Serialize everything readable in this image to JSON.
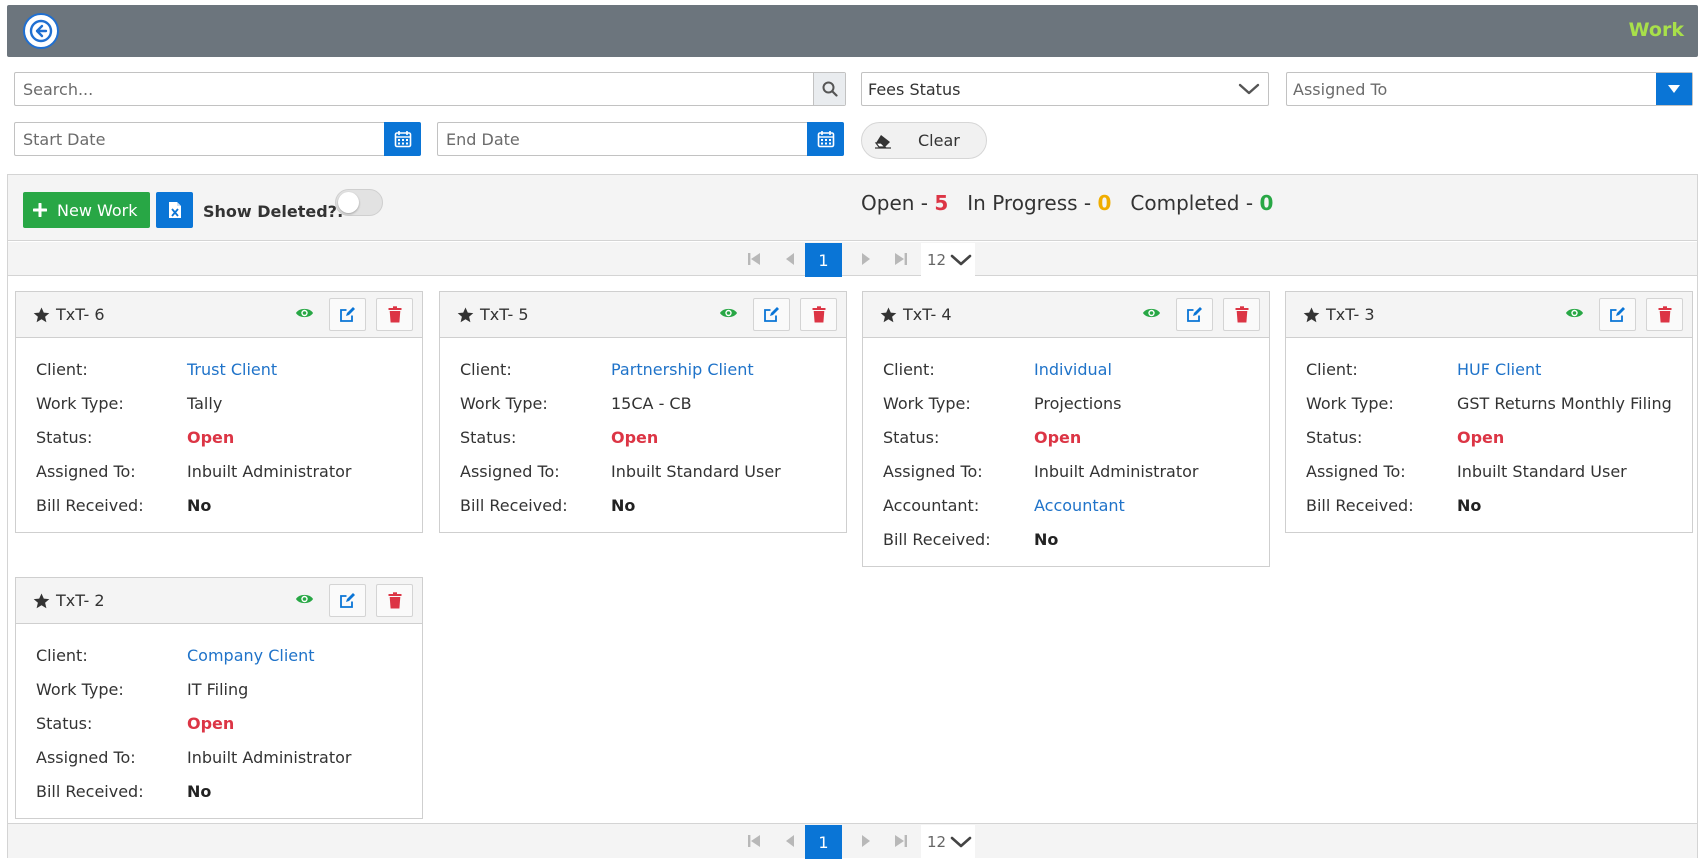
{
  "header": {
    "title": "Work"
  },
  "filters": {
    "search_placeholder": "Search...",
    "fees_status": "Fees Status",
    "assigned_to": "Assigned To",
    "start_date_placeholder": "Start Date",
    "end_date_placeholder": "End Date",
    "clear_label": "Clear"
  },
  "toolbar": {
    "new_work_label": "New Work",
    "show_deleted_label": "Show Deleted?:",
    "open_label": "Open -",
    "open_count": "5",
    "in_progress_label": "In Progress -",
    "in_progress_count": "0",
    "completed_label": "Completed -",
    "completed_count": "0"
  },
  "pager": {
    "current_page": "1",
    "page_size": "12"
  },
  "cards": [
    {
      "title": "TxT- 6",
      "rows": [
        {
          "label": "Client:",
          "value": "Trust Client",
          "style": "link"
        },
        {
          "label": "Work Type:",
          "value": "Tally",
          "style": "plain"
        },
        {
          "label": "Status:",
          "value": "Open",
          "style": "open"
        },
        {
          "label": "Assigned To:",
          "value": "Inbuilt Administrator",
          "style": "plain"
        },
        {
          "label": "Bill Received:",
          "value": "No",
          "style": "bold"
        }
      ]
    },
    {
      "title": "TxT- 5",
      "rows": [
        {
          "label": "Client:",
          "value": "Partnership Client",
          "style": "link"
        },
        {
          "label": "Work Type:",
          "value": "15CA - CB",
          "style": "plain"
        },
        {
          "label": "Status:",
          "value": "Open",
          "style": "open"
        },
        {
          "label": "Assigned To:",
          "value": "Inbuilt Standard User",
          "style": "plain"
        },
        {
          "label": "Bill Received:",
          "value": "No",
          "style": "bold"
        }
      ]
    },
    {
      "title": "TxT- 4",
      "rows": [
        {
          "label": "Client:",
          "value": "Individual",
          "style": "link"
        },
        {
          "label": "Work Type:",
          "value": "Projections",
          "style": "plain"
        },
        {
          "label": "Status:",
          "value": "Open",
          "style": "open"
        },
        {
          "label": "Assigned To:",
          "value": "Inbuilt Administrator",
          "style": "plain"
        },
        {
          "label": "Accountant:",
          "value": "Accountant",
          "style": "link"
        },
        {
          "label": "Bill Received:",
          "value": "No",
          "style": "bold"
        }
      ]
    },
    {
      "title": "TxT- 3",
      "rows": [
        {
          "label": "Client:",
          "value": "HUF Client",
          "style": "link"
        },
        {
          "label": "Work Type:",
          "value": "GST Returns Monthly Filing",
          "style": "plain"
        },
        {
          "label": "Status:",
          "value": "Open",
          "style": "open"
        },
        {
          "label": "Assigned To:",
          "value": "Inbuilt Standard User",
          "style": "plain"
        },
        {
          "label": "Bill Received:",
          "value": "No",
          "style": "bold"
        }
      ]
    },
    {
      "title": "TxT- 2",
      "rows": [
        {
          "label": "Client:",
          "value": "Company Client",
          "style": "link"
        },
        {
          "label": "Work Type:",
          "value": "IT Filing",
          "style": "plain"
        },
        {
          "label": "Status:",
          "value": "Open",
          "style": "open"
        },
        {
          "label": "Assigned To:",
          "value": "Inbuilt Administrator",
          "style": "plain"
        },
        {
          "label": "Bill Received:",
          "value": "No",
          "style": "bold"
        }
      ]
    }
  ],
  "colors": {
    "header_bg": "#6c757d",
    "title_accent": "#a8e04a",
    "primary": "#0a75d6",
    "success": "#28a745",
    "danger": "#dc3545",
    "warning": "#f0ad00",
    "link": "#1f73c9"
  }
}
